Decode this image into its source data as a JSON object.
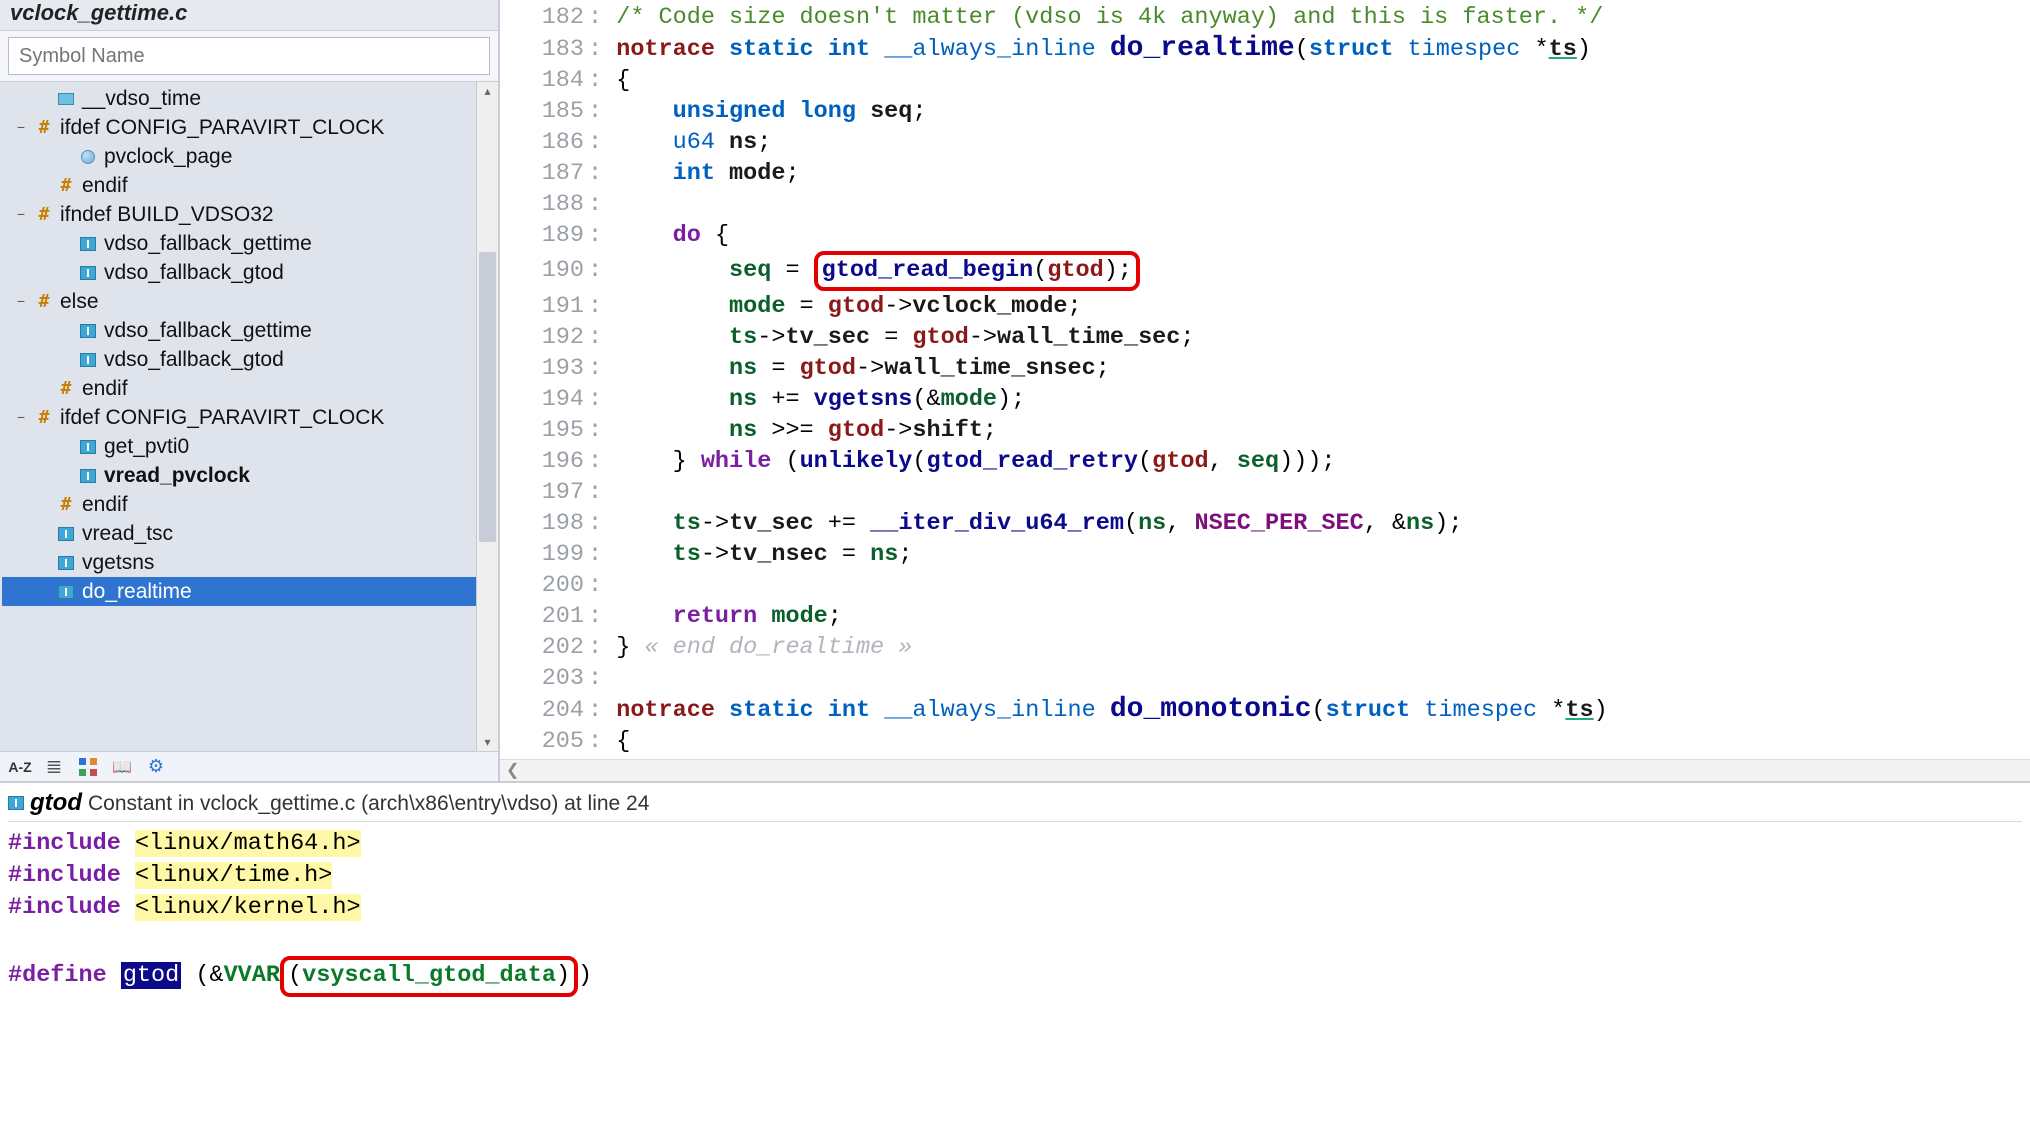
{
  "file_title": "vclock_gettime.c",
  "symbol_search_placeholder": "Symbol Name",
  "tree": [
    {
      "indent": 1,
      "expander": "",
      "icon": "folder",
      "label": "__vdso_time"
    },
    {
      "indent": 0,
      "expander": "−",
      "icon": "hash",
      "label": "ifdef CONFIG_PARAVIRT_CLOCK"
    },
    {
      "indent": 2,
      "expander": "",
      "icon": "globe",
      "label": "pvclock_page"
    },
    {
      "indent": 1,
      "expander": "",
      "icon": "hash",
      "label": "endif"
    },
    {
      "indent": 0,
      "expander": "−",
      "icon": "hash",
      "label": "ifndef BUILD_VDSO32"
    },
    {
      "indent": 2,
      "expander": "",
      "icon": "struct",
      "label": "vdso_fallback_gettime"
    },
    {
      "indent": 2,
      "expander": "",
      "icon": "struct",
      "label": "vdso_fallback_gtod"
    },
    {
      "indent": 0,
      "expander": "−",
      "icon": "hash",
      "label": "else"
    },
    {
      "indent": 2,
      "expander": "",
      "icon": "struct",
      "label": "vdso_fallback_gettime"
    },
    {
      "indent": 2,
      "expander": "",
      "icon": "struct",
      "label": "vdso_fallback_gtod"
    },
    {
      "indent": 1,
      "expander": "",
      "icon": "hash",
      "label": "endif"
    },
    {
      "indent": 0,
      "expander": "−",
      "icon": "hash",
      "label": "ifdef CONFIG_PARAVIRT_CLOCK"
    },
    {
      "indent": 2,
      "expander": "",
      "icon": "struct",
      "label": "get_pvti0"
    },
    {
      "indent": 2,
      "expander": "",
      "icon": "struct",
      "label": "vread_pvclock",
      "bold": true
    },
    {
      "indent": 1,
      "expander": "",
      "icon": "hash",
      "label": "endif"
    },
    {
      "indent": 1,
      "expander": "",
      "icon": "struct",
      "label": "vread_tsc"
    },
    {
      "indent": 1,
      "expander": "",
      "icon": "struct",
      "label": "vgetsns"
    },
    {
      "indent": 1,
      "expander": "",
      "icon": "struct",
      "label": "do_realtime",
      "selected": true
    }
  ],
  "toolbar_az": "A-Z",
  "code_lines": [
    {
      "n": 182,
      "html": "<span class='c-comment'>/* Code size doesn't matter (vdso is 4k anyway) and this is faster. */</span>"
    },
    {
      "n": 183,
      "html": "<span class='c-macro'>notrace</span> <span class='c-keyword2'>static</span> <span class='c-keyword2'>int</span> <span class='c-type'>__always_inline</span> <span class='c-funcBig'>do_realtime</span>(<span class='c-keyword2'>struct</span> <span class='c-type'>timespec</span> *<span class='c-ident c-under'>ts</span>)"
    },
    {
      "n": 184,
      "html": "{"
    },
    {
      "n": 185,
      "html": "    <span class='c-keyword2'>unsigned long</span> <span class='c-ident'>seq</span>;"
    },
    {
      "n": 186,
      "html": "    <span class='c-type'>u64</span> <span class='c-ident'>ns</span>;"
    },
    {
      "n": 187,
      "html": "    <span class='c-keyword2'>int</span> <span class='c-ident'>mode</span>;"
    },
    {
      "n": 188,
      "html": ""
    },
    {
      "n": 189,
      "html": "    <span class='c-keyword'>do</span> {"
    },
    {
      "n": 190,
      "html": "        <span class='c-var'>seq</span> = <span class='redbox'><span class='c-func'>gtod_read_begin</span>(<span class='c-field'>gtod</span>);</span>"
    },
    {
      "n": 191,
      "html": "        <span class='c-var'>mode</span> = <span class='c-field'>gtod</span>-&gt;<span class='c-ident'>vclock_mode</span>;"
    },
    {
      "n": 192,
      "html": "        <span class='c-var'>ts</span>-&gt;<span class='c-ident'>tv_sec</span> = <span class='c-field'>gtod</span>-&gt;<span class='c-ident'>wall_time_sec</span>;"
    },
    {
      "n": 193,
      "html": "        <span class='c-var'>ns</span> = <span class='c-field'>gtod</span>-&gt;<span class='c-ident'>wall_time_snsec</span>;"
    },
    {
      "n": 194,
      "html": "        <span class='c-var'>ns</span> += <span class='c-func'>vgetsns</span>(&amp;<span class='c-var'>mode</span>);"
    },
    {
      "n": 195,
      "html": "        <span class='c-var'>ns</span> &gt;&gt;= <span class='c-field'>gtod</span>-&gt;<span class='c-ident'>shift</span>;"
    },
    {
      "n": 196,
      "html": "    } <span class='c-keyword'>while</span> (<span class='c-func'>unlikely</span>(<span class='c-func'>gtod_read_retry</span>(<span class='c-field'>gtod</span>, <span class='c-var'>seq</span>)));"
    },
    {
      "n": 197,
      "html": ""
    },
    {
      "n": 198,
      "html": "    <span class='c-var'>ts</span>-&gt;<span class='c-ident'>tv_sec</span> += <span class='c-func'>__iter_div_u64_rem</span>(<span class='c-var'>ns</span>, <span class='c-const'>NSEC_PER_SEC</span>, &amp;<span class='c-var'>ns</span>);"
    },
    {
      "n": 199,
      "html": "    <span class='c-var'>ts</span>-&gt;<span class='c-ident'>tv_nsec</span> = <span class='c-var'>ns</span>;"
    },
    {
      "n": 200,
      "html": ""
    },
    {
      "n": 201,
      "html": "    <span class='c-keyword'>return</span> <span class='c-var'>mode</span>;"
    },
    {
      "n": 202,
      "html": "} <span class='ghost'>« end do_realtime »</span>"
    },
    {
      "n": 203,
      "html": ""
    },
    {
      "n": 204,
      "html": "<span class='c-macro'>notrace</span> <span class='c-keyword2'>static</span> <span class='c-keyword2'>int</span> <span class='c-type'>__always_inline</span> <span class='c-funcBig'>do_monotonic</span>(<span class='c-keyword2'>struct</span> <span class='c-type'>timespec</span> *<span class='c-ident c-under'>ts</span>)"
    },
    {
      "n": 205,
      "html": "{"
    }
  ],
  "definition": {
    "symbol": "gtod",
    "description": "Constant in vclock_gettime.c (arch\\x86\\entry\\vdso) at line 24"
  },
  "snippet_lines": [
    "<span class='c-inc'>#include</span> <span class='hl-yellow'>&lt;linux/math64.h&gt;</span>",
    "<span class='c-inc'>#include</span> <span class='hl-yellow'>&lt;linux/time.h&gt;</span>",
    "<span class='c-inc'>#include</span> <span class='hl-yellow'>&lt;linux/kernel.h&gt;</span>",
    "",
    "<span class='c-inc'>#define</span> <span class='sel-dark'>gtod</span> (&amp;<span class='c-green'>VVAR</span><span class='redbox'>(<span class='c-green'>vsyscall_gtod_data</span>)</span>)"
  ],
  "scroll_arrow": "❮"
}
